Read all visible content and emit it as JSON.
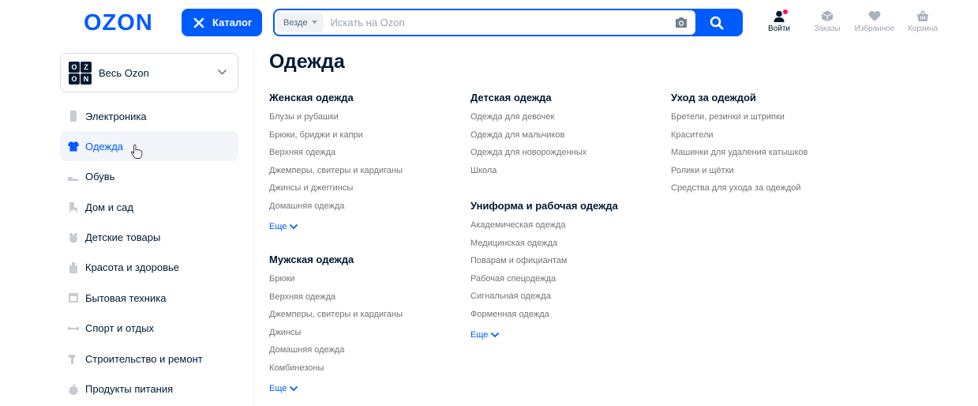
{
  "header": {
    "logo_text": "OZON",
    "catalog_label": "Каталог",
    "search": {
      "scope": "Везде",
      "placeholder": "Искать на Ozon",
      "value": ""
    },
    "items": [
      {
        "label": "Войти",
        "icon": "user-icon"
      },
      {
        "label": "Заказы",
        "icon": "box-icon"
      },
      {
        "label": "Избранное",
        "icon": "heart-icon"
      },
      {
        "label": "Корзина",
        "icon": "basket-icon"
      }
    ]
  },
  "colors": {
    "brand_blue": "#005bff",
    "text": "#001a34",
    "muted": "#70757a",
    "notification": "#f91155"
  },
  "sidebar": {
    "all_ozon": {
      "label": "Весь Ozon",
      "logo_letters": [
        "O",
        "Z",
        "O",
        "N"
      ]
    },
    "items": [
      {
        "label": "Электроника",
        "icon": "phone-icon"
      },
      {
        "label": "Одежда",
        "icon": "tshirt-icon",
        "active": true
      },
      {
        "label": "Обувь",
        "icon": "shoe-icon"
      },
      {
        "label": "Дом и сад",
        "icon": "chair-icon"
      },
      {
        "label": "Детские товары",
        "icon": "toy-icon"
      },
      {
        "label": "Красота и здоровье",
        "icon": "cosmetics-icon"
      },
      {
        "label": "Бытовая техника",
        "icon": "appliance-icon"
      },
      {
        "label": "Спорт и отдых",
        "icon": "sport-icon"
      },
      {
        "label": "Строительство и ремонт",
        "icon": "tools-icon"
      },
      {
        "label": "Продукты питания",
        "icon": "food-icon"
      }
    ]
  },
  "main": {
    "title": "Одежда",
    "more_label": "Еще",
    "columns": [
      {
        "groups": [
          {
            "title": "Женская одежда",
            "links": [
              "Блузы и рубашки",
              "Брюки, бриджи и капри",
              "Верхняя одежда",
              "Джемперы, свитеры и кардиганы",
              "Джинсы и джеггинсы",
              "Домашняя одежда"
            ],
            "more": true
          },
          {
            "title": "Мужская одежда",
            "links": [
              "Брюки",
              "Верхняя одежда",
              "Джемперы, свитеры и кардиганы",
              "Джинсы",
              "Домашняя одежда",
              "Комбинезоны"
            ],
            "more": true
          }
        ]
      },
      {
        "groups": [
          {
            "title": "Детская одежда",
            "links": [
              "Одежда для девочек",
              "Одежда для мальчиков",
              "Одежда для новорожденных",
              "Школа"
            ],
            "more": false
          },
          {
            "title": "Униформа и рабочая одежда",
            "links": [
              "Академическая одежда",
              "Медицинская одежда",
              "Поварам и официантам",
              "Рабочая спецодежда",
              "Сигнальная одежда",
              "Форменная одежда"
            ],
            "more": true
          }
        ]
      },
      {
        "groups": [
          {
            "title": "Уход за одеждой",
            "links": [
              "Бретели, резинки и штрипки",
              "Красители",
              "Машинки для удаления катышков",
              "Ролики и щётки",
              "Средства для ухода за одеждой"
            ],
            "more": false
          }
        ]
      }
    ]
  }
}
